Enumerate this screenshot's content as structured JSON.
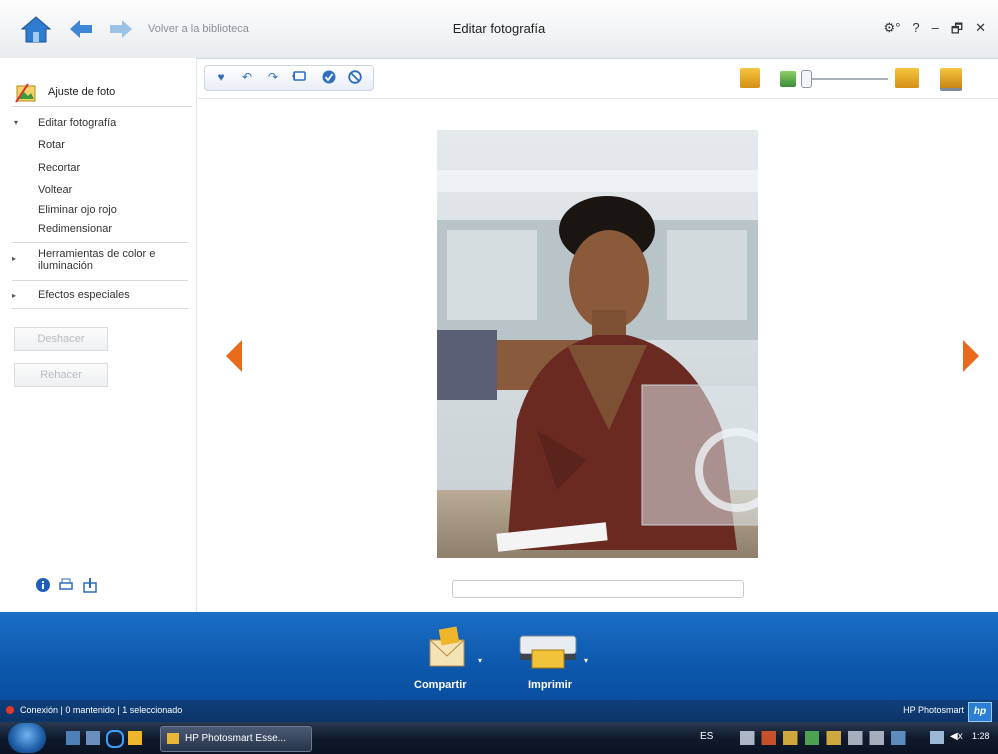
{
  "window": {
    "back_to_library": "Volver a la biblioteca",
    "title": "Editar fotografía",
    "controls": [
      "⚙°",
      "?",
      "–",
      "🗗",
      "✕"
    ]
  },
  "sidebar": {
    "header_label": "Ajuste de foto",
    "nav_section_edit": "Editar fotografía",
    "nav_items": [
      "Rotar",
      "Recortar",
      "Voltear",
      "Eliminar ojo rojo",
      "Redimensionar"
    ],
    "color_section_line1": "Herramientas de color e",
    "color_section_line2": "iluminación",
    "effects_section": "Efectos especiales",
    "undo_label": "Deshacer",
    "redo_label": "Rehacer"
  },
  "toolbar": {
    "icons": [
      "heart-icon",
      "rotate-left-icon",
      "rotate-right-icon",
      "tag-icon",
      "check-icon",
      "cancel-icon"
    ]
  },
  "bottom": {
    "share_label": "Compartir",
    "print_label": "Imprimir"
  },
  "status": {
    "text": "Conexión | 0 mantenido | 1 seleccionado",
    "brand": "HP Photosmart"
  },
  "taskbar": {
    "app_label": "HP Photosmart Esse...",
    "lang": "ES",
    "clock": "1:28"
  },
  "colors": {
    "accent_blue": "#1a6fc6",
    "nav_arrow": "#e86a1a",
    "toolbar_icon": "#2e6fc2"
  }
}
